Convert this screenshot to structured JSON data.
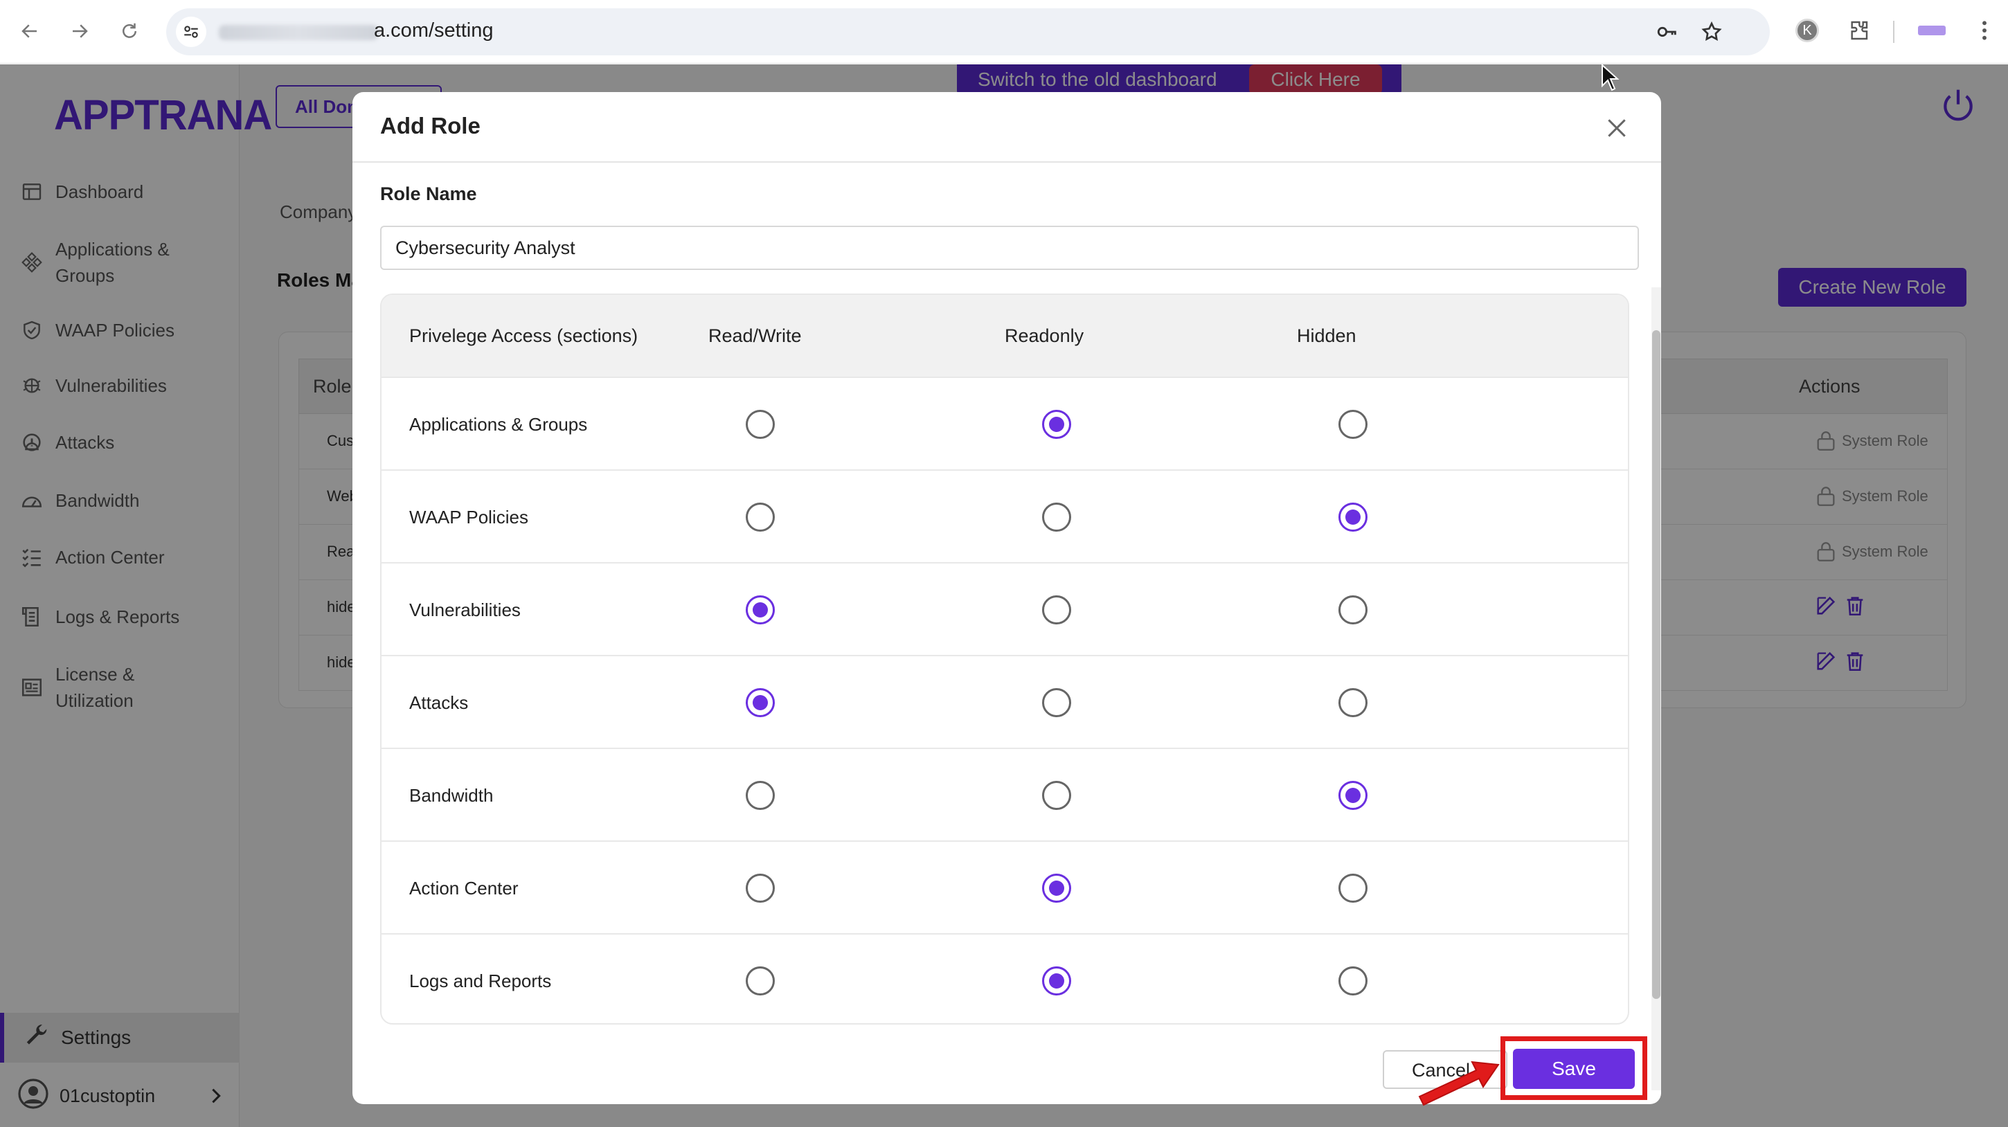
{
  "browser": {
    "url_visible": "a.com/setting"
  },
  "app": {
    "logo": "APPTRANA",
    "domain_button": "All Dom",
    "banner_text": "Switch to the old dashboard",
    "banner_button": "Click Here",
    "company_tab": "Company",
    "roles_title": "Roles Ma",
    "create_role": "Create New Role",
    "sidebar": {
      "items": [
        {
          "label": "Dashboard",
          "icon": "dashboard-icon"
        },
        {
          "label": "Applications & Groups",
          "icon": "applications-icon"
        },
        {
          "label": "WAAP Policies",
          "icon": "shield-icon"
        },
        {
          "label": "Vulnerabilities",
          "icon": "bug-icon"
        },
        {
          "label": "Attacks",
          "icon": "alert-icon"
        },
        {
          "label": "Bandwidth",
          "icon": "gauge-icon"
        },
        {
          "label": "Action Center",
          "icon": "checklist-icon"
        },
        {
          "label": "Logs & Reports",
          "icon": "logs-icon"
        },
        {
          "label": "License & Utilization",
          "icon": "license-icon"
        }
      ],
      "settings": "Settings",
      "user": "01custoptin"
    },
    "roles_table": {
      "headers": {
        "role": "Role",
        "actions": "Actions"
      },
      "rows": [
        {
          "name": "Cus",
          "action": "System Role",
          "type": "system"
        },
        {
          "name": "Web",
          "action": "System Role",
          "type": "system"
        },
        {
          "name": "Rea",
          "action": "System Role",
          "type": "system"
        },
        {
          "name": "hide",
          "action": "",
          "type": "custom"
        },
        {
          "name": "hide",
          "action": "",
          "type": "custom"
        }
      ]
    }
  },
  "modal": {
    "title": "Add Role",
    "role_name_label": "Role Name",
    "role_name_value": "Cybersecurity Analyst",
    "columns": {
      "section": "Privelege Access (sections)",
      "read_write": "Read/Write",
      "readonly": "Readonly",
      "hidden": "Hidden"
    },
    "rows": [
      {
        "name": "Applications & Groups",
        "selected": "readonly"
      },
      {
        "name": "WAAP Policies",
        "selected": "hidden"
      },
      {
        "name": "Vulnerabilities",
        "selected": "read_write"
      },
      {
        "name": "Attacks",
        "selected": "read_write"
      },
      {
        "name": "Bandwidth",
        "selected": "hidden"
      },
      {
        "name": "Action Center",
        "selected": "readonly"
      },
      {
        "name": "Logs and Reports",
        "selected": "readonly"
      }
    ],
    "cancel": "Cancel",
    "save": "Save"
  },
  "colors": {
    "accent": "#6a2fe0",
    "banner_button": "#e13a5a",
    "highlight": "#e01b1b"
  }
}
